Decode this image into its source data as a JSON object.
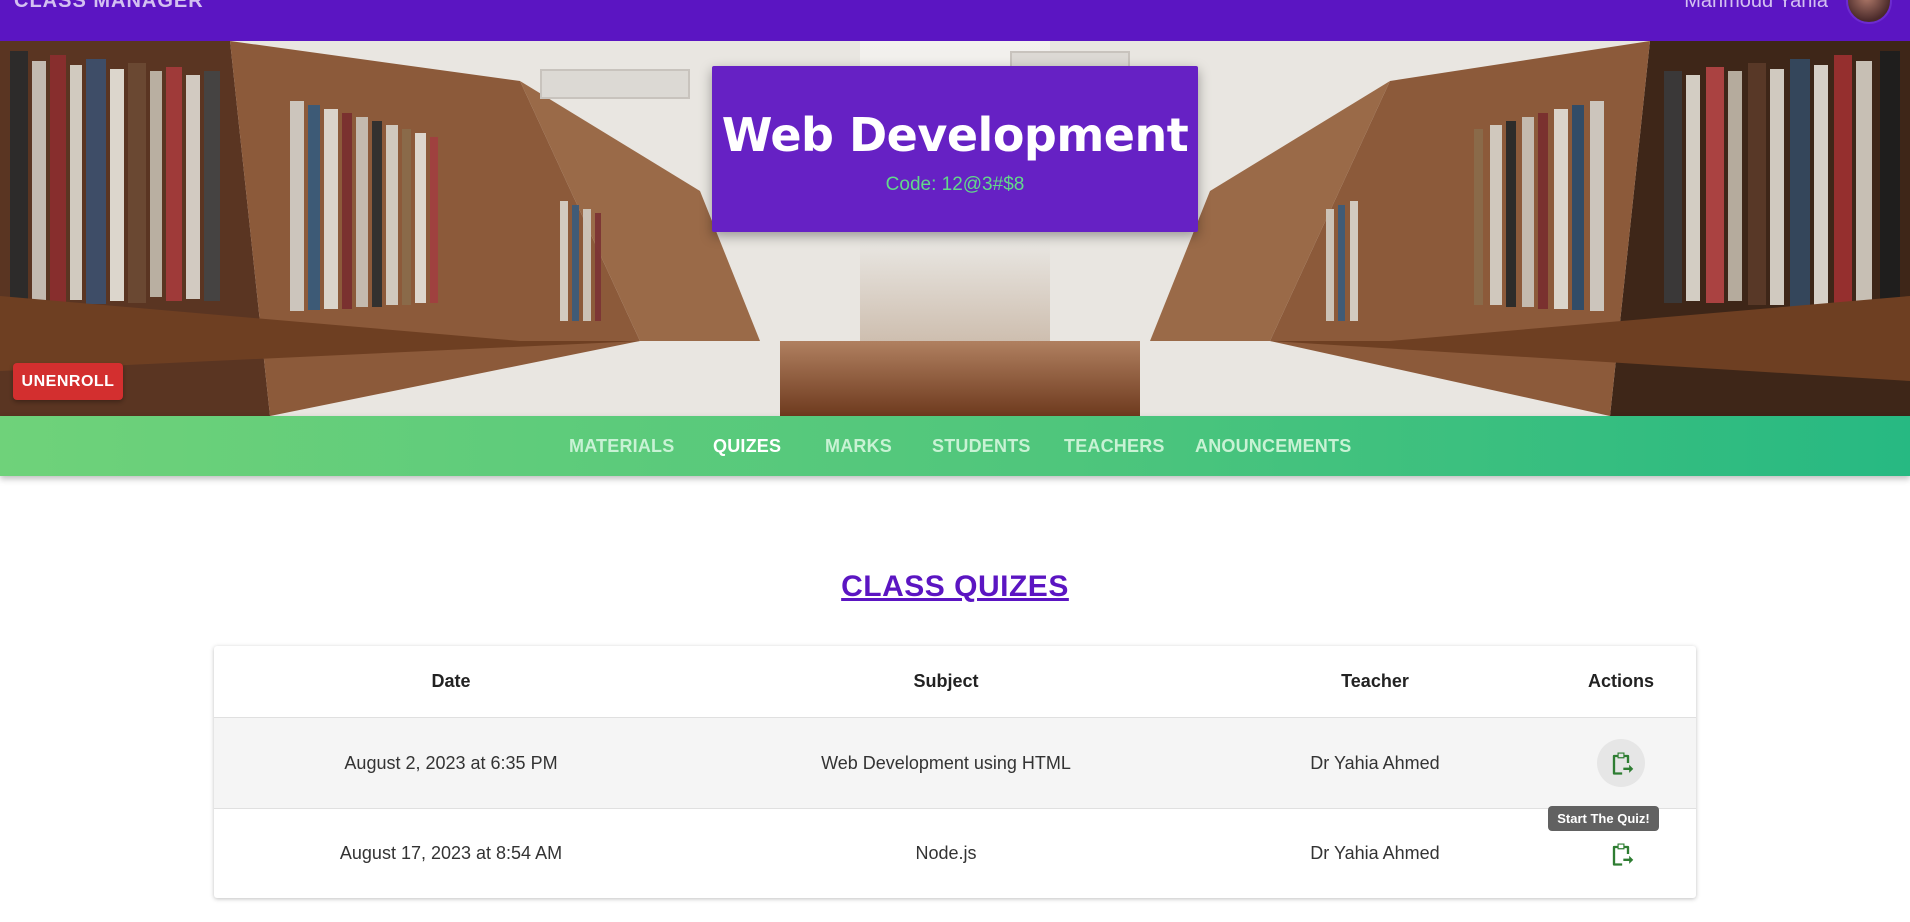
{
  "appbar": {
    "brand": "CLASS MANAGER",
    "user_name": "Mahmoud Yahia"
  },
  "hero": {
    "course_title": "Web Development",
    "course_code": "Code: 12@3#$8",
    "unenroll_label": "UNENROLL"
  },
  "tabs": [
    {
      "label": "MATERIALS",
      "active": false
    },
    {
      "label": "QUIZES",
      "active": true
    },
    {
      "label": "MARKS",
      "active": false
    },
    {
      "label": "STUDENTS",
      "active": false
    },
    {
      "label": "TEACHERS",
      "active": false
    },
    {
      "label": "ANOUNCEMENTS",
      "active": false
    }
  ],
  "main": {
    "section_title": "CLASS QUIZES",
    "table": {
      "headers": [
        "Date",
        "Subject",
        "Teacher",
        "Actions"
      ],
      "rows": [
        {
          "date": "August 2, 2023 at 6:35 PM",
          "subject": "Web Development using HTML",
          "teacher": "Dr Yahia Ahmed",
          "action_icon": "clipboard-arrow-icon"
        },
        {
          "date": "August 17, 2023 at 8:54 AM",
          "subject": "Node.js",
          "teacher": "Dr Yahia Ahmed",
          "action_icon": "clipboard-arrow-icon"
        }
      ]
    },
    "tooltip": "Start The Quiz!"
  },
  "colors": {
    "appbar": "#5b15c2",
    "title_card": "#6621c4",
    "code_text": "#63d98a",
    "unenroll": "#d32f2f",
    "tabs_start": "#6fd27a",
    "tabs_end": "#27b982",
    "section_title": "#5b15c2",
    "quiz_icon": "#2e7d32"
  }
}
